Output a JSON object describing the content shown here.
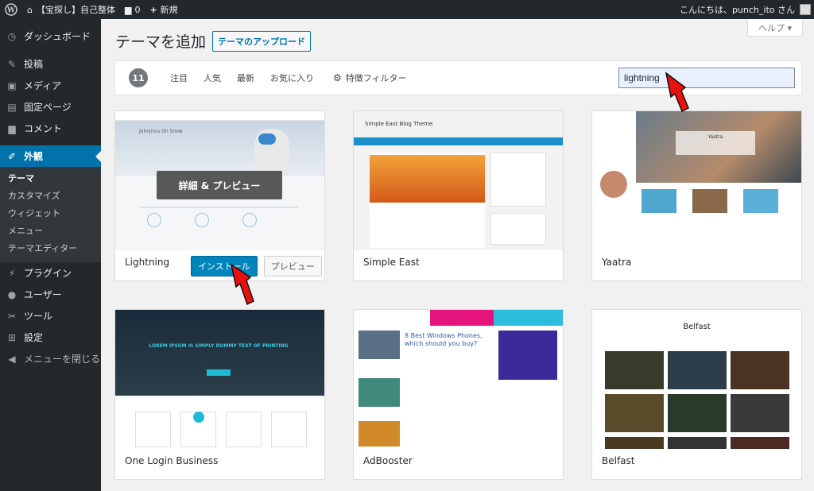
{
  "adminbar": {
    "site_name": "【宝探し】自己整体",
    "comment_count": "0",
    "new_label": "新規",
    "greeting": "こんにちは、punch_ito さん"
  },
  "sidebar": {
    "items": [
      {
        "label": "ダッシュボード",
        "icon": "dashboard-icon"
      },
      {
        "label": "投稿",
        "icon": "pin-icon"
      },
      {
        "label": "メディア",
        "icon": "media-icon"
      },
      {
        "label": "固定ページ",
        "icon": "page-icon"
      },
      {
        "label": "コメント",
        "icon": "comment-icon"
      },
      {
        "label": "外観",
        "icon": "appearance-icon"
      },
      {
        "label": "プラグイン",
        "icon": "plugin-icon"
      },
      {
        "label": "ユーザー",
        "icon": "user-icon"
      },
      {
        "label": "ツール",
        "icon": "wrench-icon"
      },
      {
        "label": "設定",
        "icon": "settings-icon"
      },
      {
        "label": "メニューを閉じる",
        "icon": "collapse-icon"
      }
    ],
    "submenu": [
      "テーマ",
      "カスタマイズ",
      "ウィジェット",
      "メニュー",
      "テーマエディター"
    ]
  },
  "page": {
    "title": "テーマを追加",
    "upload_label": "テーマのアップロード",
    "help_label": "ヘルプ ▾"
  },
  "filter": {
    "count": "11",
    "tabs": [
      "注目",
      "人気",
      "最新",
      "お気に入り"
    ],
    "feature_filter": "特徴フィルター",
    "search_value": "lightning"
  },
  "themes": [
    {
      "name": "Lightning",
      "overlay": "詳細 & プレビュー",
      "install": "インストール",
      "preview": "プレビュー",
      "shot_caption": "Johnjirou On Snow"
    },
    {
      "name": "Simple East",
      "shot_caption": "Simple East Blog Theme"
    },
    {
      "name": "Yaatra",
      "shot_caption": "Yaatra"
    },
    {
      "name": "One Login Business",
      "shot_caption": "LOREM IPSUM IS SIMPLY DUMMY TEXT OF PRINTING"
    },
    {
      "name": "AdBooster",
      "shot_caption": "8 Best Windows Phones, which should you buy?"
    },
    {
      "name": "Belfast",
      "shot_caption": "Belfast"
    }
  ],
  "colors": {
    "accent": "#0073aa",
    "arrow": "#e8110f"
  }
}
